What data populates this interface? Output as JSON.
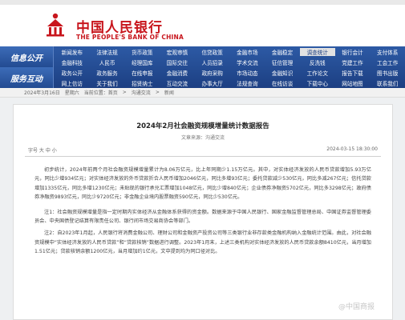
{
  "header": {
    "title_cn": "中国人民银行",
    "title_en": "THE PEOPLE'S BANK OF CHINA"
  },
  "nav": {
    "rows": [
      {
        "label": "信息公开",
        "lines": [
          [
            "新闻发布",
            "法律法规",
            "货币政策",
            "宏观审慎",
            "信贷政策",
            "金融市场",
            "金融稳定",
            "调查统计",
            "银行会计",
            "支付体系"
          ],
          [
            "金融科技",
            "人民币",
            "经理国库",
            "国际交往",
            "人员招录",
            "学术交流",
            "征信管理",
            "反洗钱",
            "党建工作",
            "工会工作"
          ]
        ],
        "selected": "调查统计"
      },
      {
        "label": "服务互动",
        "lines": [
          [
            "政务公开",
            "政务服务",
            "在线申报",
            "金融消费",
            "政府采购",
            "市场动态",
            "金融知识",
            "工作论文",
            "报告下载",
            "图书出版"
          ],
          [
            "网上信访",
            "关于我们",
            "招贤纳士",
            "互动交流",
            "办事大厅",
            "法规查询",
            "在线访谈",
            "下载中心",
            "网站地图",
            "联系我们"
          ]
        ],
        "selected": ""
      }
    ]
  },
  "breadcrumb": [
    "2024年3月16日",
    "星期六",
    "当前位置：首页",
    "沟通交流",
    "新闻"
  ],
  "article": {
    "title": "2024年2月社会融资规模增量统计数据报告",
    "source": "文章来源：沟通交流",
    "meta_left": "字号 大 中 小",
    "meta_right": "2024-03-15 18:30:00",
    "paragraphs": [
      "初步统计，2024年前两个月社会融资规模增量累计为8.06万亿元，比上年同期少1.15万亿元。其中，对实体经济发放的人民币贷款增加5.93万亿元，同比少增934亿元；对实体经济发放的外币贷款折合人民币增加2046亿元，同比多增93亿元；委托贷款减少530亿元，同比多减267亿元；信托贷款增加1335亿元，同比多增1230亿元；未贴现的银行承兑汇票增加1048亿元，同比少增840亿元；企业债券净融资5702亿元，同比多3298亿元；政府债券净融资9893亿元，同比少9720亿元；非金融企业境内股票融资590亿元，同比少530亿元。",
      "注1：社会融资规模增量是指一定时期内实体经济从金融体系获得的资金额。数据来源于中国人民银行、国家金融监督管理总局、中国证券监督管理委员会、中央国债登记结算有限责任公司、银行间市场交易商协会等部门。",
      "注2：自2023年1月起，人民银行将消费金融公司、理财公司和金融资产投资公司等三类银行业非存款类金融机构纳入金融统计范围。由此，对社会融资规模中“实体经济发放的人民币贷款”和“贷款核销”数据进行调整。2023年1月末，上述三类机构对实体经济发放的人民币贷款余额8410亿元，当月增加1.51亿元；贷款核销余额1200亿元，当月增加约1亿元，文中提到均为同口径对比。"
    ]
  },
  "watermark": "@中国商报"
}
